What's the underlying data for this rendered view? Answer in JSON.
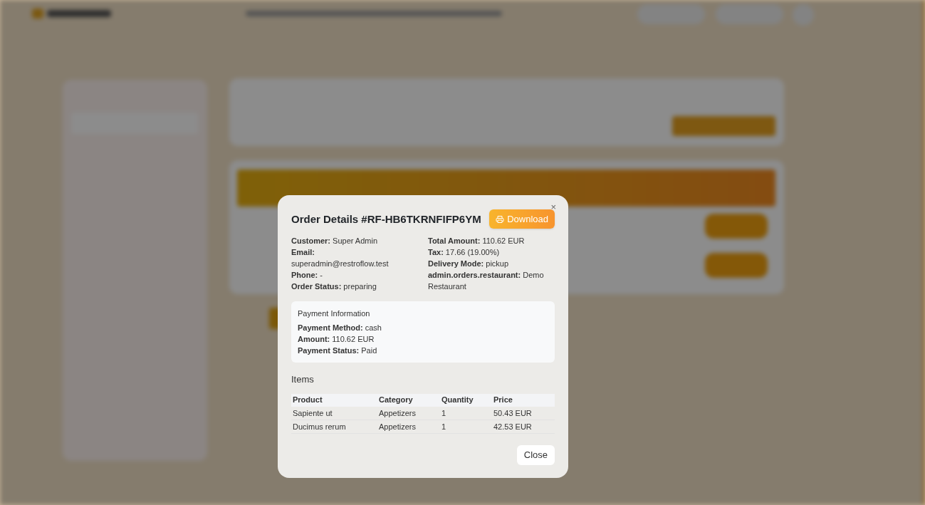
{
  "dialog": {
    "title": "Order Details #RF-HB6TKRNFIFP6YM",
    "download_button": "Download",
    "close_icon": "×",
    "details_left": [
      "**Customer:** Super Admin",
      "**Email:** superadmin@restroflow.test",
      "**Phone:** -",
      "**Order Status:** preparing"
    ],
    "details_right": [
      "**Total Amount:** 110.62 EUR",
      "**Tax:** 17.66 (19.00%)",
      "**Delivery Mode:** pickup",
      "**admin.orders.restaurant:** Demo Restaurant"
    ],
    "payment": {
      "title": "Payment Information",
      "fields": [
        "**Payment Method:** cash",
        "**Amount:** 110.62 EUR",
        "**Payment Status:** Paid"
      ]
    },
    "items": {
      "title": "Items",
      "columns": [
        "Product",
        "Category",
        "Quantity",
        "Price"
      ],
      "rows": [
        [
          "Sapiente ut",
          "Appetizers",
          "1",
          "50.43 EUR"
        ],
        [
          "Ducimus rerum",
          "Appetizers",
          "1",
          "42.53 EUR"
        ]
      ]
    },
    "close_button": "Close"
  }
}
